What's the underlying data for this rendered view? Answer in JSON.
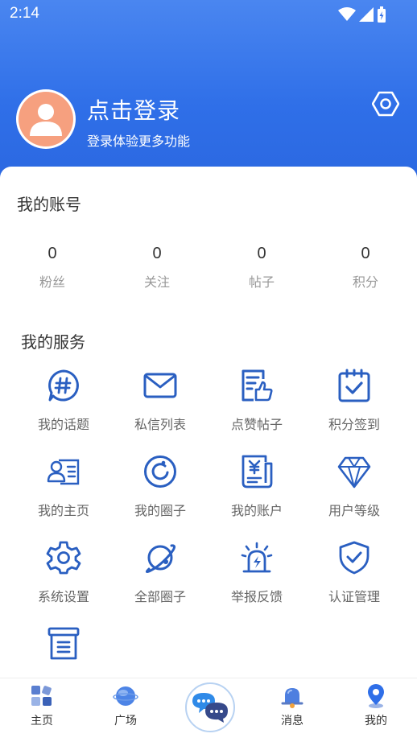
{
  "status_bar": {
    "time": "2:14"
  },
  "profile": {
    "login_title": "点击登录",
    "login_subtitle": "登录体验更多功能"
  },
  "account": {
    "section_title": "我的账号",
    "stats": [
      {
        "value": "0",
        "label": "粉丝"
      },
      {
        "value": "0",
        "label": "关注"
      },
      {
        "value": "0",
        "label": "帖子"
      },
      {
        "value": "0",
        "label": "积分"
      }
    ]
  },
  "services": {
    "section_title": "我的服务",
    "items": [
      {
        "label": "我的话题",
        "icon": "hashtag-chat-icon"
      },
      {
        "label": "私信列表",
        "icon": "envelope-icon"
      },
      {
        "label": "点赞帖子",
        "icon": "thumbs-up-document-icon"
      },
      {
        "label": "积分签到",
        "icon": "calendar-check-icon"
      },
      {
        "label": "我的主页",
        "icon": "profile-card-icon"
      },
      {
        "label": "我的圈子",
        "icon": "circle-icon"
      },
      {
        "label": "我的账户",
        "icon": "yen-document-icon"
      },
      {
        "label": "用户等级",
        "icon": "diamond-icon"
      },
      {
        "label": "系统设置",
        "icon": "gear-icon"
      },
      {
        "label": "全部圈子",
        "icon": "planet-icon"
      },
      {
        "label": "举报反馈",
        "icon": "alarm-light-icon"
      },
      {
        "label": "认证管理",
        "icon": "shield-check-icon"
      },
      {
        "label": "",
        "icon": "archive-box-icon"
      }
    ]
  },
  "bottom_nav": {
    "items": [
      {
        "label": "主页",
        "icon": "home-cubes-icon"
      },
      {
        "label": "广场",
        "icon": "globe-icon"
      },
      {
        "label": "",
        "icon": "chat-bubbles-icon"
      },
      {
        "label": "消息",
        "icon": "bell-icon"
      },
      {
        "label": "我的",
        "icon": "location-pin-icon"
      }
    ]
  },
  "colors": {
    "header_blue": "#2f6fe8",
    "icon_blue": "#2a5fc1",
    "avatar_orange": "#f6a07f"
  }
}
